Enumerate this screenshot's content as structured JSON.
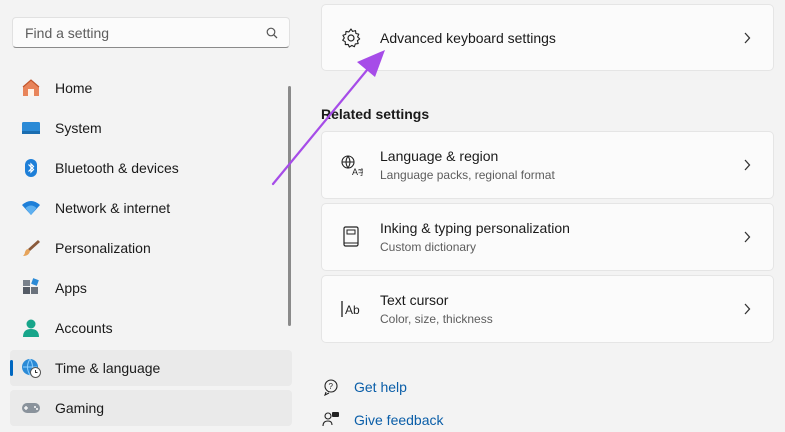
{
  "search": {
    "placeholder": "Find a setting",
    "icon": "search-icon"
  },
  "sidebar": {
    "items": [
      {
        "label": "Home",
        "icon": "home-icon"
      },
      {
        "label": "System",
        "icon": "system-icon"
      },
      {
        "label": "Bluetooth & devices",
        "icon": "bluetooth-icon"
      },
      {
        "label": "Network & internet",
        "icon": "wifi-icon"
      },
      {
        "label": "Personalization",
        "icon": "brush-icon"
      },
      {
        "label": "Apps",
        "icon": "apps-icon"
      },
      {
        "label": "Accounts",
        "icon": "accounts-icon"
      },
      {
        "label": "Time & language",
        "icon": "globe-clock-icon",
        "selected": true
      },
      {
        "label": "Gaming",
        "icon": "gamepad-icon"
      }
    ]
  },
  "main": {
    "top_card": {
      "title": "Advanced keyboard settings",
      "icon": "gear-icon"
    },
    "related_settings_title": "Related settings",
    "related": [
      {
        "title": "Language & region",
        "subtitle": "Language packs, regional format",
        "icon": "language-icon"
      },
      {
        "title": "Inking & typing personalization",
        "subtitle": "Custom dictionary",
        "icon": "book-icon"
      },
      {
        "title": "Text cursor",
        "subtitle": "Color, size, thickness",
        "icon": "text-cursor-icon"
      }
    ],
    "help_links": [
      {
        "label": "Get help",
        "icon": "help-icon"
      },
      {
        "label": "Give feedback",
        "icon": "feedback-icon"
      }
    ]
  },
  "colors": {
    "accent": "#0067c0",
    "link": "#0a5ea8",
    "annotation_arrow": "#a64ce8"
  }
}
